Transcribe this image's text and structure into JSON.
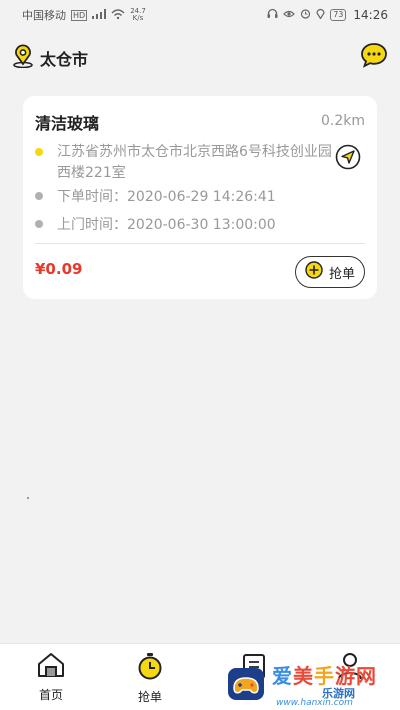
{
  "status_bar": {
    "carrier": "中国移动",
    "net_speed_value": "24.7",
    "net_speed_unit": "K/s",
    "battery": "73",
    "time": "14:26"
  },
  "header": {
    "city": "太仓市",
    "location_icon": "location-pin-icon",
    "message_icon": "chat-bubble-icon"
  },
  "order": {
    "title": "清洁玻璃",
    "distance": "0.2km",
    "address": "江苏省苏州市太仓市北京西路6号科技创业园西楼221室",
    "order_time": "下单时间：2020-06-29 14:26:41",
    "visit_time": "上门时间：2020-06-30 13:00:00",
    "price": "¥0.09",
    "grab_label": "抢单"
  },
  "tabs": [
    {
      "label": "首页",
      "icon": "home-icon"
    },
    {
      "label": "抢单",
      "icon": "stopwatch-icon"
    },
    {
      "label": "",
      "icon": "order-icon"
    },
    {
      "label": "",
      "icon": "user-icon"
    }
  ],
  "watermark": {
    "title_a": "爱",
    "title_b": "美",
    "title_c": "手",
    "title_d": "游网",
    "sub": "乐游网",
    "url": "www.hanxin.com"
  },
  "colors": {
    "accent_yellow": "#f5d80f",
    "price_red": "#e8382c",
    "background": "#f2f2f2"
  }
}
